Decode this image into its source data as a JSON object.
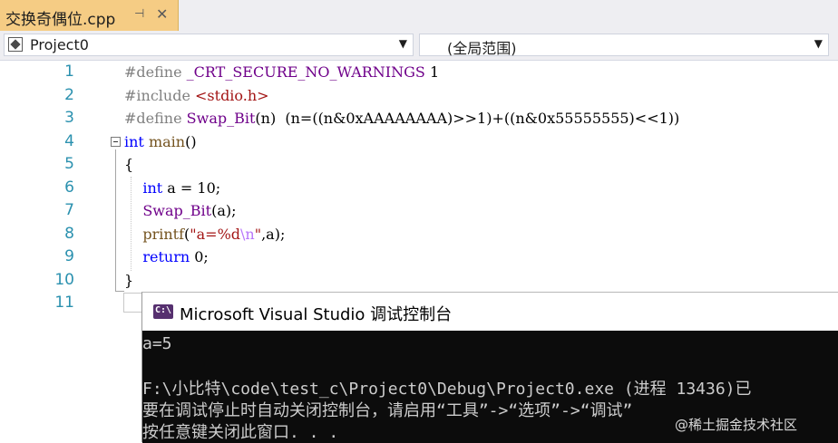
{
  "tab": {
    "title": "交换奇偶位.cpp",
    "pin_icon": "pin-icon",
    "close_icon": "close-icon"
  },
  "navbar": {
    "project": {
      "label": "Project0",
      "icon": "project-icon"
    },
    "scope": {
      "label": "(全局范围)"
    },
    "dropdown_icon": "chevron-down-icon"
  },
  "editor": {
    "line_numbers": [
      "1",
      "2",
      "3",
      "4",
      "5",
      "6",
      "7",
      "8",
      "9",
      "10",
      "11"
    ],
    "lines": [
      [
        {
          "t": "#define ",
          "c": "pp"
        },
        {
          "t": "_CRT_SECURE_NO_WARNINGS",
          "c": "mac"
        },
        {
          "t": " 1",
          "c": ""
        }
      ],
      [
        {
          "t": "#include ",
          "c": "pp"
        },
        {
          "t": "<stdio.h>",
          "c": "str"
        }
      ],
      [
        {
          "t": "#define ",
          "c": "pp"
        },
        {
          "t": "Swap_Bit",
          "c": "mac"
        },
        {
          "t": "(n)  (n=((n&0xAAAAAAAA)>>1)+((n&0x55555555)<<1))",
          "c": ""
        }
      ],
      [
        {
          "t": "int",
          "c": "kw"
        },
        {
          "t": " main",
          "c": "fn"
        },
        {
          "t": "()",
          "c": ""
        }
      ],
      [
        {
          "t": "{",
          "c": ""
        }
      ],
      [
        {
          "t": "    int",
          "c": "kw"
        },
        {
          "t": " a = 10;",
          "c": ""
        }
      ],
      [
        {
          "t": "    Swap_Bit",
          "c": "mac"
        },
        {
          "t": "(a);",
          "c": ""
        }
      ],
      [
        {
          "t": "    printf",
          "c": "fn"
        },
        {
          "t": "(",
          "c": ""
        },
        {
          "t": "\"a=%d",
          "c": "str"
        },
        {
          "t": "\\n",
          "c": "esc"
        },
        {
          "t": "\"",
          "c": "str"
        },
        {
          "t": ",a);",
          "c": ""
        }
      ],
      [
        {
          "t": "    return",
          "c": "kw"
        },
        {
          "t": " 0;",
          "c": ""
        }
      ],
      [
        {
          "t": "}",
          "c": ""
        }
      ],
      []
    ]
  },
  "console": {
    "title": "Microsoft Visual Studio 调试控制台",
    "icon": "vs-console-icon",
    "icon_text": "C:\\",
    "lines": [
      "a=5",
      "",
      "F:\\小比特\\code\\test_c\\Project0\\Debug\\Project0.exe (进程 13436)已",
      "要在调试停止时自动关闭控制台，请启用“工具”->“选项”->“调试”",
      "按任意键关闭此窗口. . ."
    ]
  },
  "watermark": "@稀土掘金技术社区"
}
